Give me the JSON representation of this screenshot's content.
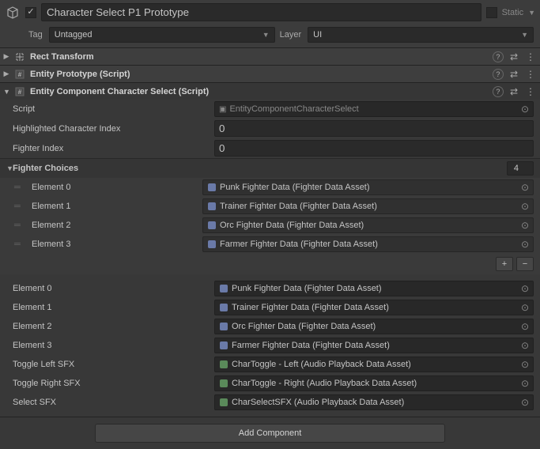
{
  "header": {
    "name": "Character Select P1 Prototype",
    "static_label": "Static",
    "tag_label": "Tag",
    "tag_value": "Untagged",
    "layer_label": "Layer",
    "layer_value": "UI"
  },
  "components": {
    "rect": {
      "title": "Rect Transform"
    },
    "entity_proto": {
      "title": "Entity Prototype (Script)"
    },
    "eccs": {
      "title": "Entity Component Character Select (Script)",
      "script_label": "Script",
      "script_value": "EntityComponentCharacterSelect",
      "hci_label": "Highlighted Character Index",
      "hci_value": "0",
      "fi_label": "Fighter Index",
      "fi_value": "0",
      "fighter_choices_label": "Fighter Choices",
      "fighter_choices_size": "4",
      "elements": [
        {
          "label": "Element 0",
          "value": "Punk Fighter Data (Fighter Data Asset)"
        },
        {
          "label": "Element 1",
          "value": "Trainer Fighter Data (Fighter Data Asset)"
        },
        {
          "label": "Element 2",
          "value": "Orc Fighter Data (Fighter Data Asset)"
        },
        {
          "label": "Element 3",
          "value": "Farmer Fighter Data (Fighter Data Asset)"
        }
      ],
      "elements2": [
        {
          "label": "Element 0",
          "value": "Punk Fighter Data (Fighter Data Asset)"
        },
        {
          "label": "Element 1",
          "value": "Trainer Fighter Data (Fighter Data Asset)"
        },
        {
          "label": "Element 2",
          "value": "Orc Fighter Data (Fighter Data Asset)"
        },
        {
          "label": "Element 3",
          "value": "Farmer Fighter Data (Fighter Data Asset)"
        }
      ],
      "toggle_left_label": "Toggle Left SFX",
      "toggle_left_value": "CharToggle - Left (Audio Playback Data Asset)",
      "toggle_right_label": "Toggle Right SFX",
      "toggle_right_value": "CharToggle - Right (Audio Playback Data Asset)",
      "select_sfx_label": "Select SFX",
      "select_sfx_value": "CharSelectSFX (Audio Playback Data Asset)"
    }
  },
  "add_component": "Add Component"
}
